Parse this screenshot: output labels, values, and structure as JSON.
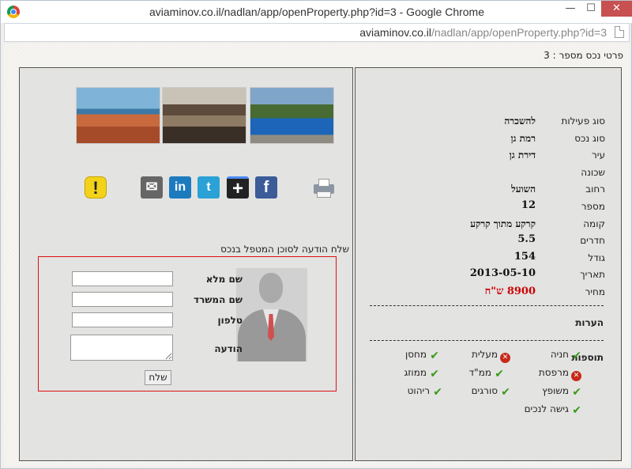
{
  "window": {
    "title": "aviaminov.co.il/nadlan/app/openProperty.php?id=3 - Google Chrome",
    "minimize": "—",
    "maximize": "☐",
    "close": "✕"
  },
  "address": {
    "host": "aviaminov.co.il",
    "path": "/nadlan/app/openProperty.php?id=3"
  },
  "page": {
    "heading": "פרטי נכס מספר : 3"
  },
  "details": [
    {
      "label": "סוג פעילות",
      "value": "להשכרה"
    },
    {
      "label": "סוג נכס",
      "value": "רמת גן"
    },
    {
      "label": "עיר",
      "value": "דירת גן"
    },
    {
      "label": "שכונה",
      "value": ""
    },
    {
      "label": "רחוב",
      "value": "השועל"
    },
    {
      "label": "מספר",
      "value": "12"
    },
    {
      "label": "קומה",
      "value": "קרקע מתוך קרקע"
    },
    {
      "label": "חדרים",
      "value": "5.5"
    },
    {
      "label": "גודל",
      "value": "154"
    },
    {
      "label": "תאריך",
      "value": "2013-05-10"
    },
    {
      "label": "מחיר",
      "value": "8900 ש\"ח"
    }
  ],
  "notes_label": "הערות",
  "extras_label": "תוספות",
  "features": [
    {
      "label": "חניה",
      "status": "yes"
    },
    {
      "label": "מעלית",
      "status": "no"
    },
    {
      "label": "מחסן",
      "status": "yes"
    },
    {
      "label": "מרפסת",
      "status": "no"
    },
    {
      "label": "ממ\"ד",
      "status": "yes"
    },
    {
      "label": "ממוזג",
      "status": "yes"
    },
    {
      "label": "משופץ",
      "status": "yes"
    },
    {
      "label": "סורגים",
      "status": "yes"
    },
    {
      "label": "ריהוט",
      "status": "yes"
    },
    {
      "label": "גישה לנכים",
      "status": "yes"
    }
  ],
  "icons": {
    "warn": "!",
    "mail": "✉",
    "linkedin": "in",
    "twitter": "t",
    "plus": "+",
    "facebook": "f"
  },
  "contact_form": {
    "title": "שלח הודעה לסוכן המטפל בנכס",
    "full_name_label": "שם מלא",
    "office_name_label": "שם המשרד",
    "phone_label": "טלפון",
    "message_label": "הודעה",
    "submit_label": "שלח",
    "full_name_value": "",
    "office_name_value": "",
    "phone_value": "",
    "message_value": ""
  },
  "colors": {
    "price": "#cc0000",
    "check": "#3a9a1a",
    "cross": "#c62a1a",
    "form_border": "#dd1111"
  }
}
